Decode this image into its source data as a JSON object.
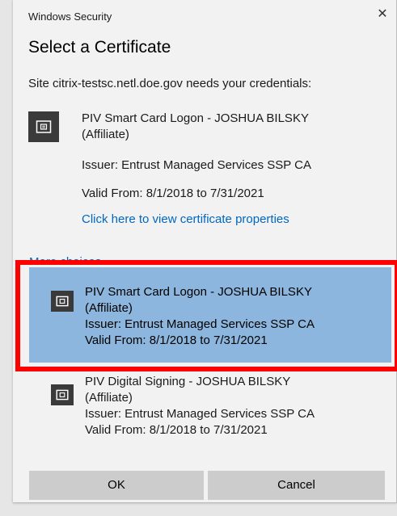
{
  "window": {
    "title": "Windows Security",
    "close_glyph": "✕"
  },
  "heading": "Select a Certificate",
  "site_message": "Site citrix-testsc.netl.doe.gov needs your credentials:",
  "primary_cert": {
    "icon": "certificate-card-icon",
    "name_line1": "PIV Smart Card Logon - JOSHUA BILSKY",
    "name_line2": "(Affiliate)",
    "issuer": "Issuer: Entrust Managed Services SSP CA",
    "valid": "Valid From: 8/1/2018 to 7/31/2021",
    "properties_link": "Click here to view certificate properties"
  },
  "more_choices_label": "More choices",
  "choices": [
    {
      "icon": "certificate-card-icon",
      "name_line1": "PIV Smart Card Logon - JOSHUA BILSKY",
      "name_line2": "(Affiliate)",
      "issuer": "Issuer: Entrust Managed Services SSP CA",
      "valid": "Valid From: 8/1/2018 to 7/31/2021",
      "selected": true
    },
    {
      "icon": "certificate-card-icon",
      "name_line1": "PIV Digital Signing - JOSHUA BILSKY",
      "name_line2": "(Affiliate)",
      "issuer": "Issuer: Entrust Managed Services SSP CA",
      "valid": "Valid From: 8/1/2018 to 7/31/2021",
      "selected": false
    }
  ],
  "buttons": {
    "ok": "OK",
    "cancel": "Cancel"
  },
  "colors": {
    "selection": "#8cb6dd",
    "highlight_frame": "#ff0000",
    "link": "#0067c0",
    "button": "#cccccc"
  }
}
